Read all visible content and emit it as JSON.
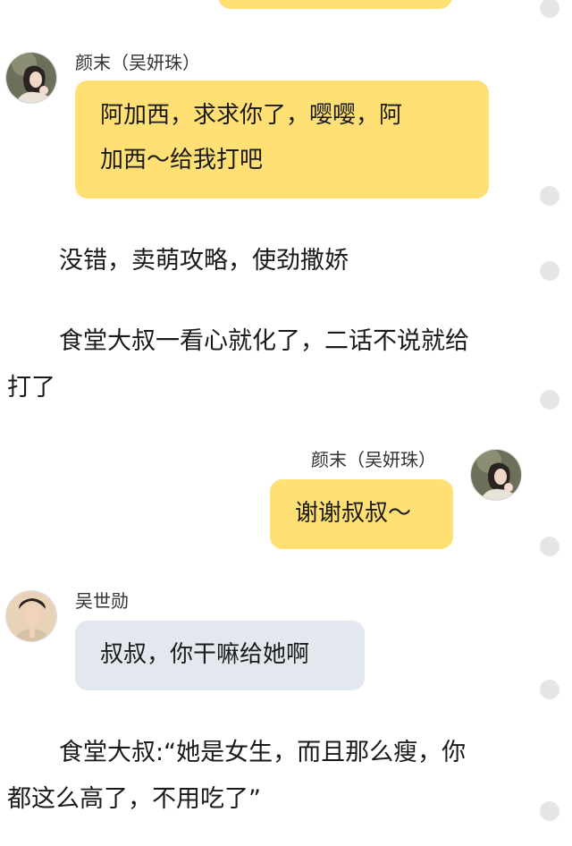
{
  "messages": [
    {
      "sender": "颜末（吴妍珠）",
      "text_line1": "阿加西，求求你了，嘤嘤，阿",
      "text_line2": "加西～给我打吧"
    },
    {
      "sender": "颜末（吴妍珠）",
      "text": "谢谢叔叔～"
    },
    {
      "sender": "吴世勋",
      "text": "叔叔，你干嘛给她啊"
    }
  ],
  "narration": {
    "p1": "没错，卖萌攻略，使劲撒娇",
    "p2_line1": "食堂大叔一看心就化了，二话不说就给",
    "p2_line2": "打了",
    "p3_line1": "食堂大叔:“她是女生，而且那么瘦，你",
    "p3_line2": "都这么高了，不用吃了”"
  },
  "colors": {
    "bubble_yellow": "#ffe074",
    "bubble_gray": "#e3e8ee"
  }
}
